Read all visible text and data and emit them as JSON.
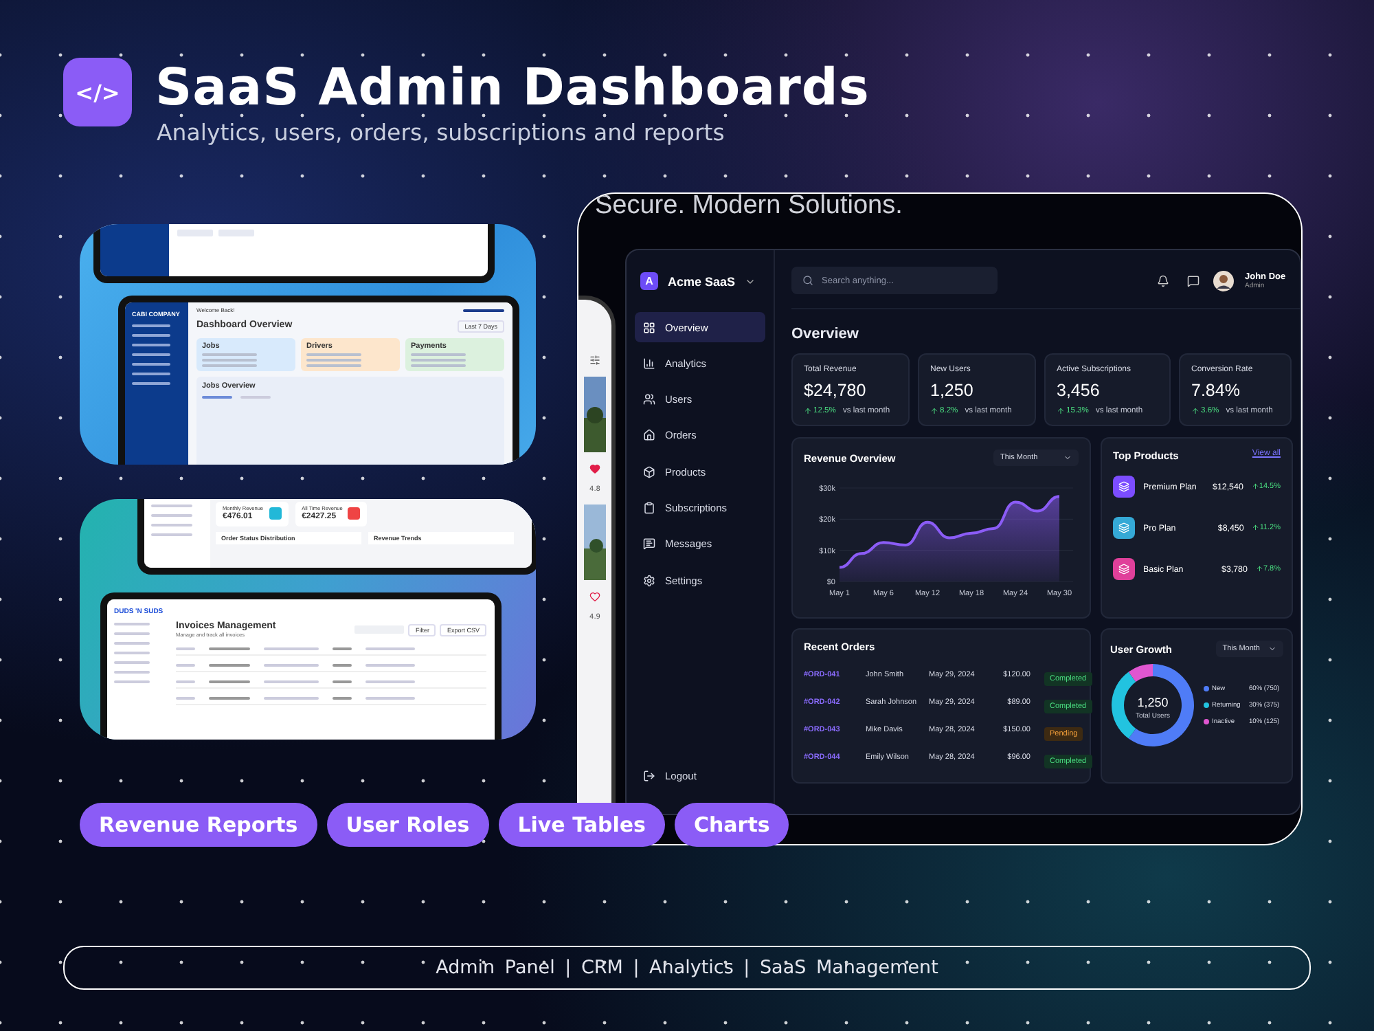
{
  "header": {
    "logo": "</>",
    "title": "SaaS Admin Dashboards",
    "subtitle": "Analytics, users, orders, subscriptions and reports"
  },
  "previews": [
    {
      "kind": "cabi",
      "brand": "CABI COMPANY",
      "welcome": "Welcome Back!",
      "heading": "Dashboard Overview",
      "range": "Last 7 Days",
      "cards": [
        {
          "title": "Jobs",
          "color": "#d8eafc"
        },
        {
          "title": "Drivers",
          "color": "#fde6cc"
        },
        {
          "title": "Payments",
          "color": "#dcf1de"
        }
      ],
      "panel": "Jobs Overview"
    },
    {
      "kind": "invoices",
      "stats": [
        {
          "label": "Monthly Revenue",
          "value": "€476.01",
          "color": "#22b8d8"
        },
        {
          "label": "All Time Revenue",
          "value": "€2427.25",
          "color": "#ef4444"
        }
      ],
      "panels": [
        "Order Status Distribution",
        "Revenue Trends"
      ],
      "brand": "DUDS 'N SUDS",
      "heading": "Invoices Management",
      "subheading": "Manage and track all invoices",
      "buttons": [
        "Filter",
        "Export CSV"
      ]
    }
  ],
  "tags": [
    "Revenue Reports",
    "User Roles",
    "Live Tables",
    "Charts"
  ],
  "showcase": {
    "tagline": "Secure. Modern Solutions.",
    "phone": {
      "ratings": [
        "4.8",
        "4.9"
      ]
    },
    "dashboard": {
      "brand": {
        "logo": "A",
        "name": "Acme SaaS"
      },
      "nav": [
        {
          "label": "Overview",
          "selected": true
        },
        {
          "label": "Analytics",
          "selected": false
        },
        {
          "label": "Users",
          "selected": false
        },
        {
          "label": "Orders",
          "selected": false
        },
        {
          "label": "Products",
          "selected": false
        },
        {
          "label": "Subscriptions",
          "selected": false
        },
        {
          "label": "Messages",
          "selected": false
        },
        {
          "label": "Settings",
          "selected": false
        }
      ],
      "logout": "Logout",
      "search": {
        "placeholder": "Search anything..."
      },
      "user": {
        "name": "John Doe",
        "role": "Admin"
      },
      "page_title": "Overview",
      "stats": [
        {
          "label": "Total Revenue",
          "value": "$24,780",
          "change": "12.5%",
          "note": "vs last month"
        },
        {
          "label": "New Users",
          "value": "1,250",
          "change": "8.2%",
          "note": "vs last month"
        },
        {
          "label": "Active Subscriptions",
          "value": "3,456",
          "change": "15.3%",
          "note": "vs last month"
        },
        {
          "label": "Conversion Rate",
          "value": "7.84%",
          "change": "3.6%",
          "note": "vs last month"
        }
      ],
      "revenue": {
        "title": "Revenue Overview",
        "period": "This Month",
        "chart_data": {
          "type": "area",
          "categories": [
            "May 1",
            null,
            "May 6",
            null,
            "May 12",
            null,
            "May 18",
            null,
            "May 24",
            null,
            "May 30"
          ],
          "series": [
            {
              "color": "#8b5cf6",
              "values": [
                4500,
                9000,
                12500,
                11700,
                19000,
                14000,
                15500,
                17000,
                25500,
                22600,
                27300
              ]
            }
          ],
          "ylim": [
            0,
            30000
          ],
          "yticks": [
            {
              "value": 0,
              "label": "$0"
            },
            {
              "value": 10000,
              "label": "$10k"
            },
            {
              "value": 20000,
              "label": "$20k"
            },
            {
              "value": 30000,
              "label": "$30k"
            }
          ]
        }
      },
      "top_products": {
        "title": "Top Products",
        "link": "View all",
        "items": [
          {
            "name": "Premium Plan",
            "amount": "$12,540",
            "change": "14.5%",
            "color": "#7c4dff"
          },
          {
            "name": "Pro Plan",
            "amount": "$8,450",
            "change": "11.2%",
            "color": "#35a9d6"
          },
          {
            "name": "Basic Plan",
            "amount": "$3,780",
            "change": "7.8%",
            "color": "#e0409a"
          }
        ]
      },
      "orders": {
        "title": "Recent Orders",
        "rows": [
          {
            "id": "#ORD-041",
            "customer": "John Smith",
            "date": "May 29, 2024",
            "amount": "$120.00",
            "status": "Completed",
            "kind": "completed"
          },
          {
            "id": "#ORD-042",
            "customer": "Sarah Johnson",
            "date": "May 29, 2024",
            "amount": "$89.00",
            "status": "Completed",
            "kind": "completed"
          },
          {
            "id": "#ORD-043",
            "customer": "Mike Davis",
            "date": "May 28, 2024",
            "amount": "$150.00",
            "status": "Pending",
            "kind": "pending"
          },
          {
            "id": "#ORD-044",
            "customer": "Emily Wilson",
            "date": "May 28, 2024",
            "amount": "$96.00",
            "status": "Completed",
            "kind": "completed"
          }
        ]
      },
      "user_growth": {
        "title": "User Growth",
        "period": "This Month",
        "total": "1,250",
        "total_label": "Total Users",
        "chart_data": {
          "type": "donut",
          "categories": [
            "New",
            "Returning",
            "Inactive"
          ],
          "values": [
            60,
            30,
            10
          ]
        },
        "legend": [
          {
            "value": "60% (750)",
            "color": "#4f7cf7"
          },
          {
            "value": "30% (375)",
            "color": "#22c3e0"
          },
          {
            "value": "10% (125)",
            "color": "#e056d0"
          }
        ]
      }
    }
  },
  "footer": "Admin Panel | CRM | Analytics | SaaS Management"
}
